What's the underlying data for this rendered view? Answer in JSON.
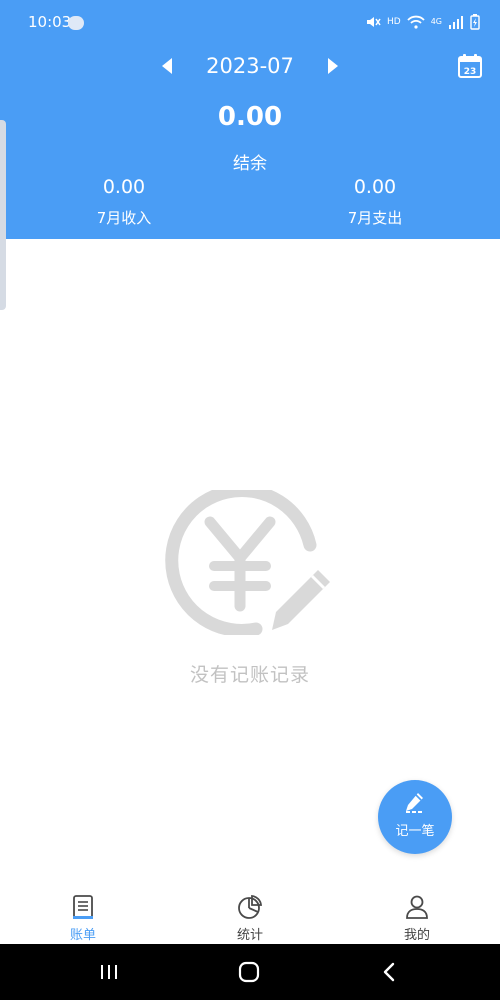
{
  "status_bar": {
    "time": "10:03",
    "hd": "HD",
    "network": "4G"
  },
  "header": {
    "month": "2023-07",
    "balance_value": "0.00",
    "balance_label": "结余",
    "income_value": "0.00",
    "income_label": "7月收入",
    "expense_value": "0.00",
    "expense_label": "7月支出",
    "calendar_day": "23",
    "background_color": "#4a9df5"
  },
  "empty_state": {
    "message": "没有记账记录",
    "icon": "yen-pencil-icon"
  },
  "fab": {
    "label": "记一笔",
    "icon": "pencil-icon"
  },
  "tabs": [
    {
      "label": "账单",
      "icon": "bill-icon",
      "active": true
    },
    {
      "label": "统计",
      "icon": "pie-chart-icon",
      "active": false
    },
    {
      "label": "我的",
      "icon": "person-icon",
      "active": false
    }
  ],
  "accent_color": "#4a9df5"
}
